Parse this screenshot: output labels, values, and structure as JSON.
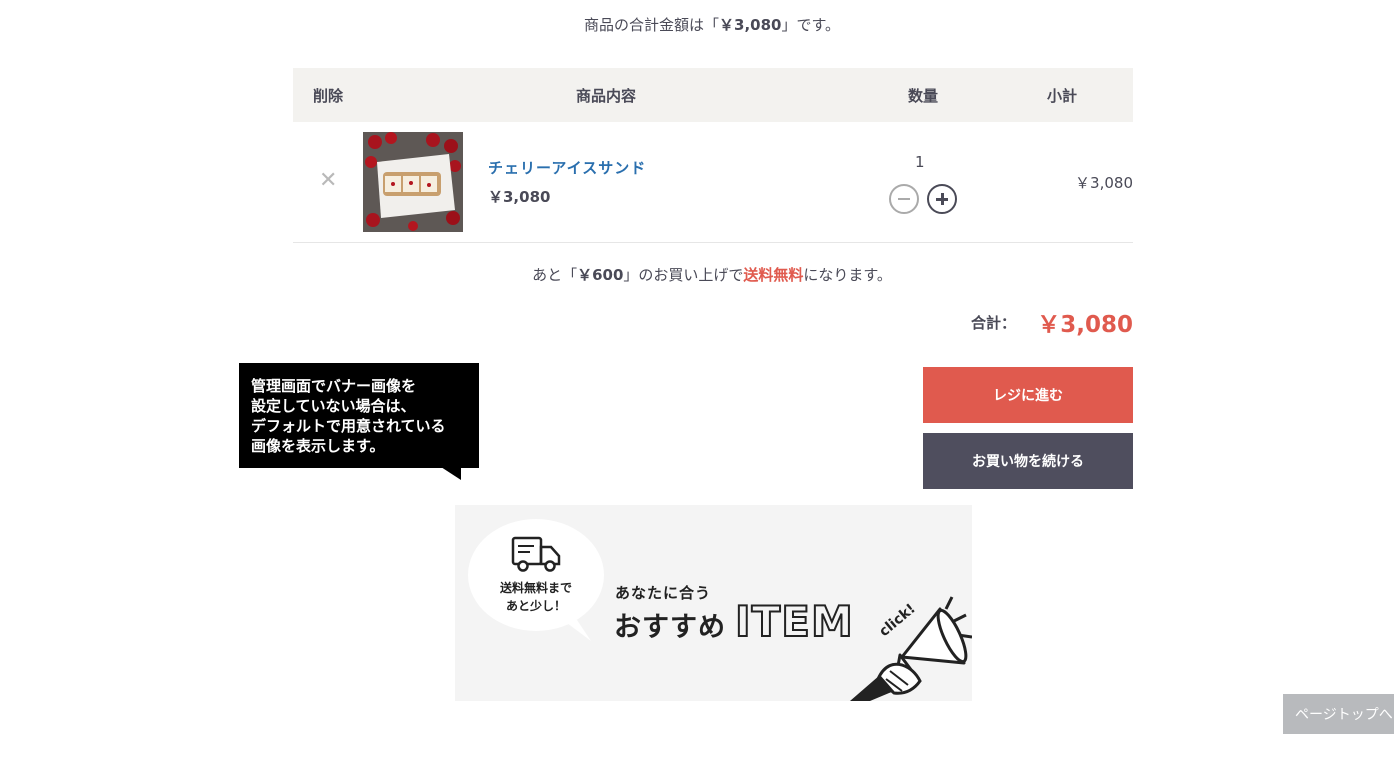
{
  "summary": {
    "prefix": "商品の合計金額は「",
    "amount": "￥3,080",
    "suffix": "」です。"
  },
  "table": {
    "headers": {
      "delete": "削除",
      "item": "商品内容",
      "quantity": "数量",
      "subtotal": "小計"
    },
    "rows": [
      {
        "name": "チェリーアイスサンド",
        "price": "￥3,080",
        "quantity": "1",
        "subtotal": "￥3,080"
      }
    ]
  },
  "free_shipping": {
    "prefix": "あと「",
    "amount": "￥600",
    "middle": "」のお買い上げで",
    "highlight": "送料無料",
    "suffix": "になります。"
  },
  "total": {
    "label": "合計：",
    "value": "￥3,080"
  },
  "buttons": {
    "checkout": "レジに進む",
    "continue": "お買い物を続ける"
  },
  "tooltip": {
    "lines": [
      "管理画面でバナー画像を",
      "設定していない場合は、",
      "デフォルトで用意されている",
      "画像を表示します。"
    ]
  },
  "banner": {
    "bubble_line1": "送料無料まで",
    "bubble_line2": "あと少し！",
    "sub": "あなたに合う",
    "main": "おすすめ",
    "item": "ITEM",
    "click": "click!"
  },
  "page_top": "ページトップへ",
  "colors": {
    "accent_red": "#e05a4e",
    "dark_button": "#4f4e5e",
    "link_blue": "#2a6fae",
    "header_bg": "#f3f2ef"
  },
  "icons": {
    "delete": "close-icon",
    "minus": "minus-icon",
    "plus": "plus-icon",
    "truck": "truck-icon",
    "megaphone": "megaphone-icon"
  }
}
